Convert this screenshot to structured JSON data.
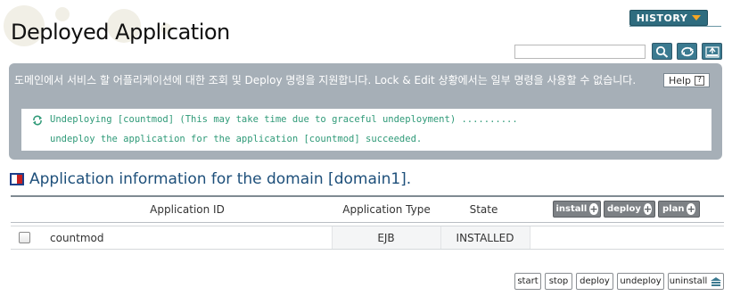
{
  "page": {
    "title": "Deployed Application",
    "history_label": "HISTORY"
  },
  "search": {
    "value": "",
    "placeholder": ""
  },
  "icons": {
    "search": "search-icon",
    "refresh": "refresh-icon",
    "export": "xml-export-icon"
  },
  "info": {
    "description": "도메인에서 서비스 할 어플리케이션에 대한 조회 및 Deploy 명령을 지원합니다. Lock & Edit 상황에서는 일부 명령을 사용할 수 없습니다.",
    "help_label": "Help",
    "help_icon_text": "?",
    "messages": [
      "Undeploying [countmod] (This may take time due to graceful undeployment) ..........",
      "undeploy the application for the application [countmod] succeeded."
    ]
  },
  "section": {
    "title": "Application information for the domain [domain1]."
  },
  "table": {
    "headers": {
      "id": "Application ID",
      "type": "Application Type",
      "state": "State"
    },
    "buttons": {
      "install": "install",
      "deploy": "deploy",
      "plan": "plan"
    },
    "rows": [
      {
        "id": "countmod",
        "type": "EJB",
        "state": "INSTALLED",
        "checked": false
      }
    ]
  },
  "actions": {
    "start": "start",
    "stop": "stop",
    "deploy": "deploy",
    "undeploy": "undeploy",
    "uninstall": "uninstall"
  },
  "colors": {
    "history_bg": "#2e6c7f",
    "info_bg": "#a6afb7",
    "message_text": "#2f9a78",
    "section_title": "#1d4f7a",
    "table_button_bg": "#7d8185"
  }
}
